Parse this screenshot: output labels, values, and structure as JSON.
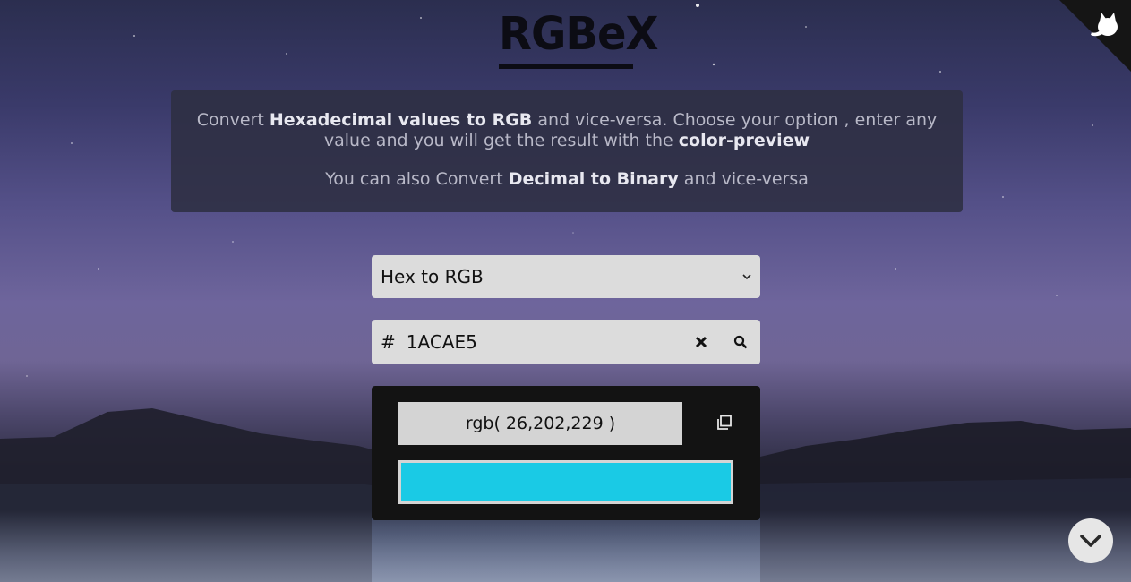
{
  "logo": {
    "title": "RGBeX"
  },
  "info": {
    "line1_pre": "Convert ",
    "line1_bold": "Hexadecimal values to RGB",
    "line1_mid": " and vice-versa. Choose your option , enter any value and you will get the result with the ",
    "line1_bold2": "color-preview",
    "line2_pre": "You can also Convert ",
    "line2_bold": "Decimal to Binary",
    "line2_post": " and vice-versa"
  },
  "converter": {
    "mode_selected": "Hex to RGB",
    "input_prefix": "#",
    "input_value": "1ACAE5",
    "result_text": "rgb( 26,202,229 )",
    "preview_color": "#1ACAE5"
  },
  "icons": {
    "clear": "close-icon",
    "search": "search-icon",
    "copy": "copy-icon",
    "github": "github-icon",
    "scroll": "chevron-down-icon"
  }
}
